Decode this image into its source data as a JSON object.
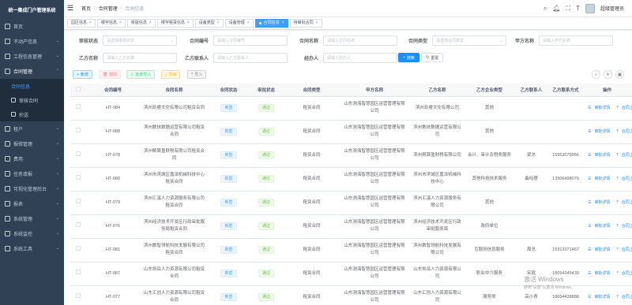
{
  "app": {
    "title": "统一集成门户管理系统"
  },
  "sidebar": {
    "items": [
      {
        "label": "首页",
        "icon": "home-icon"
      },
      {
        "label": "不动产信息",
        "icon": "building-icon"
      },
      {
        "label": "工程信息管理",
        "icon": "project-icon"
      },
      {
        "label": "合同管理",
        "icon": "contract-icon"
      },
      {
        "label": "租户",
        "icon": "tenant-icon"
      },
      {
        "label": "报修管理",
        "icon": "repair-icon"
      },
      {
        "label": "费用",
        "icon": "fee-icon"
      },
      {
        "label": "任务填报",
        "icon": "task-icon"
      },
      {
        "label": "可视化管理后台",
        "icon": "visual-icon"
      },
      {
        "label": "报表",
        "icon": "report-icon"
      },
      {
        "label": "系统管理",
        "icon": "settings-icon"
      },
      {
        "label": "系统监控",
        "icon": "monitor-icon"
      },
      {
        "label": "系统工具",
        "icon": "tool-icon"
      }
    ],
    "sub": [
      "合同信息",
      "审核合同",
      "抄送"
    ]
  },
  "header": {
    "breadcrumb": [
      "首页",
      "合同管理",
      "合同信息"
    ],
    "username": "超级管理员"
  },
  "tags": [
    {
      "label": "园区信息"
    },
    {
      "label": "楼宇信息"
    },
    {
      "label": "房屋信息"
    },
    {
      "label": "楼宇租赁信息"
    },
    {
      "label": "设备类型"
    },
    {
      "label": "设备管理"
    },
    {
      "label": "合同信息",
      "active": true
    },
    {
      "label": "待审批合同"
    }
  ],
  "form": {
    "audit_status": {
      "label": "审核状态",
      "placeholder": "请选择审批状态"
    },
    "contract_no": {
      "label": "合同编号",
      "placeholder": "请输入合同编号"
    },
    "contract_name": {
      "label": "合同名称",
      "placeholder": "请输入合同名称"
    },
    "contract_type": {
      "label": "合同类型",
      "placeholder": "请选择合同类型"
    },
    "party_a": {
      "label": "甲方名称",
      "placeholder": "请输入甲方名称"
    },
    "party_b": {
      "label": "乙方名称",
      "placeholder": "请输入乙方名称"
    },
    "party_b_contact": {
      "label": "乙方联系人",
      "placeholder": "请输入乙方联系人"
    },
    "handler": {
      "label": "经办人",
      "placeholder": "请输入经办人"
    },
    "search": "搜索",
    "reset": "重置"
  },
  "toolbar": {
    "add": "新增",
    "delete": "删除",
    "import": "批量导入",
    "export": "导出",
    "upload": "导入"
  },
  "table": {
    "headers": [
      "合同编号",
      "合同名称",
      "合同状态",
      "审批状态",
      "合同类型",
      "甲方名称",
      "乙方名称",
      "乙方企业类型",
      "乙方联系人",
      "乙方联系方式",
      "操作"
    ],
    "rows": [
      [
        "HT-084",
        "滨州玖睿文化有限公司租赁合同",
        "新签",
        "通过",
        "租赁合同",
        "山东测海智慧园区运营管理有限公司",
        "滨州玖睿文化有限公司",
        "其他",
        "",
        "",
        "审批详情",
        "合同上传"
      ],
      [
        "HT-088",
        "滨州数技数据运营有限公司租赁合同",
        "新签",
        "通过",
        "租赁合同",
        "山东测海智慧园区运营管理有限公司",
        "滨州数技数据运营有限公司",
        "其他",
        "",
        "",
        "审批详情",
        "合同上传"
      ],
      [
        "HT-078",
        "滨州鲸算盈财税有限公司租赁合同",
        "新签",
        "通过",
        "租赁合同",
        "山东测海智慧园区运营管理有限公司",
        "滨州鲸算盈财税有限公司",
        "会计、审计及税务服务",
        "梁总",
        "15963079966",
        "审批详情",
        "合同上传"
      ],
      [
        "HT-080",
        "滨州市滨城区嘉泽机械科技中心租赁合同",
        "新签",
        "通过",
        "租赁合同",
        "山东测海智慧园区运营管理有限公司",
        "滨州市滨城区嘉泽机械科技中心",
        "其他科技技术服务",
        "曲经理",
        "13306498079",
        "审批详情",
        "合同上传"
      ],
      [
        "HT-079",
        "滨州汇溪人力资源服务有限公司租赁合同",
        "新签",
        "通过",
        "租赁合同",
        "山东测海智慧园区运营管理有限公司",
        "滨州汇溪人力资源服务有限公司",
        "其他",
        "",
        "",
        "审批详情",
        "合同上传"
      ],
      [
        "HT-076",
        "滨州经济技术开发区行政审批服务局租赁合同",
        "新签",
        "通过",
        "租赁合同",
        "山东测海智慧园区运营管理有限公司",
        "滨州经济技术开发区行政审批服务局",
        "政府单位",
        "",
        "",
        "审批详情",
        "合同上传"
      ],
      [
        "HT-081",
        "滨州数智领航科技发展有限公司租赁合同",
        "新签",
        "通过",
        "租赁合同",
        "山东测海智慧园区运营管理有限公司",
        "滨州数智领航科技发展有限公司",
        "互联网信息服务",
        "周总",
        "15312071467",
        "审批详情",
        "合同上传"
      ],
      [
        "HT-087",
        "山东凯岳人力资源有限公司租赁合同",
        "新签",
        "通过",
        "租赁合同",
        "山东测海智慧园区运营管理有限公司",
        "山东凯岳人力资源有限公司",
        "职业中介服务",
        "宋霞",
        "18054345439",
        "审批详情",
        "合同上传"
      ],
      [
        "HT-077",
        "山东汇创人力资源有限公司租赁合同",
        "新签",
        "通过",
        "租赁合同",
        "山东测海智慧园区运营管理有限公司",
        "山东汇创人力资源有限公司",
        "服务类",
        "高小青",
        "18054438888",
        "审批详情",
        "合同上传"
      ]
    ]
  },
  "watermark": {
    "line1": "激活 Windows",
    "line2": "转到“设置”以激活 Windows。"
  }
}
